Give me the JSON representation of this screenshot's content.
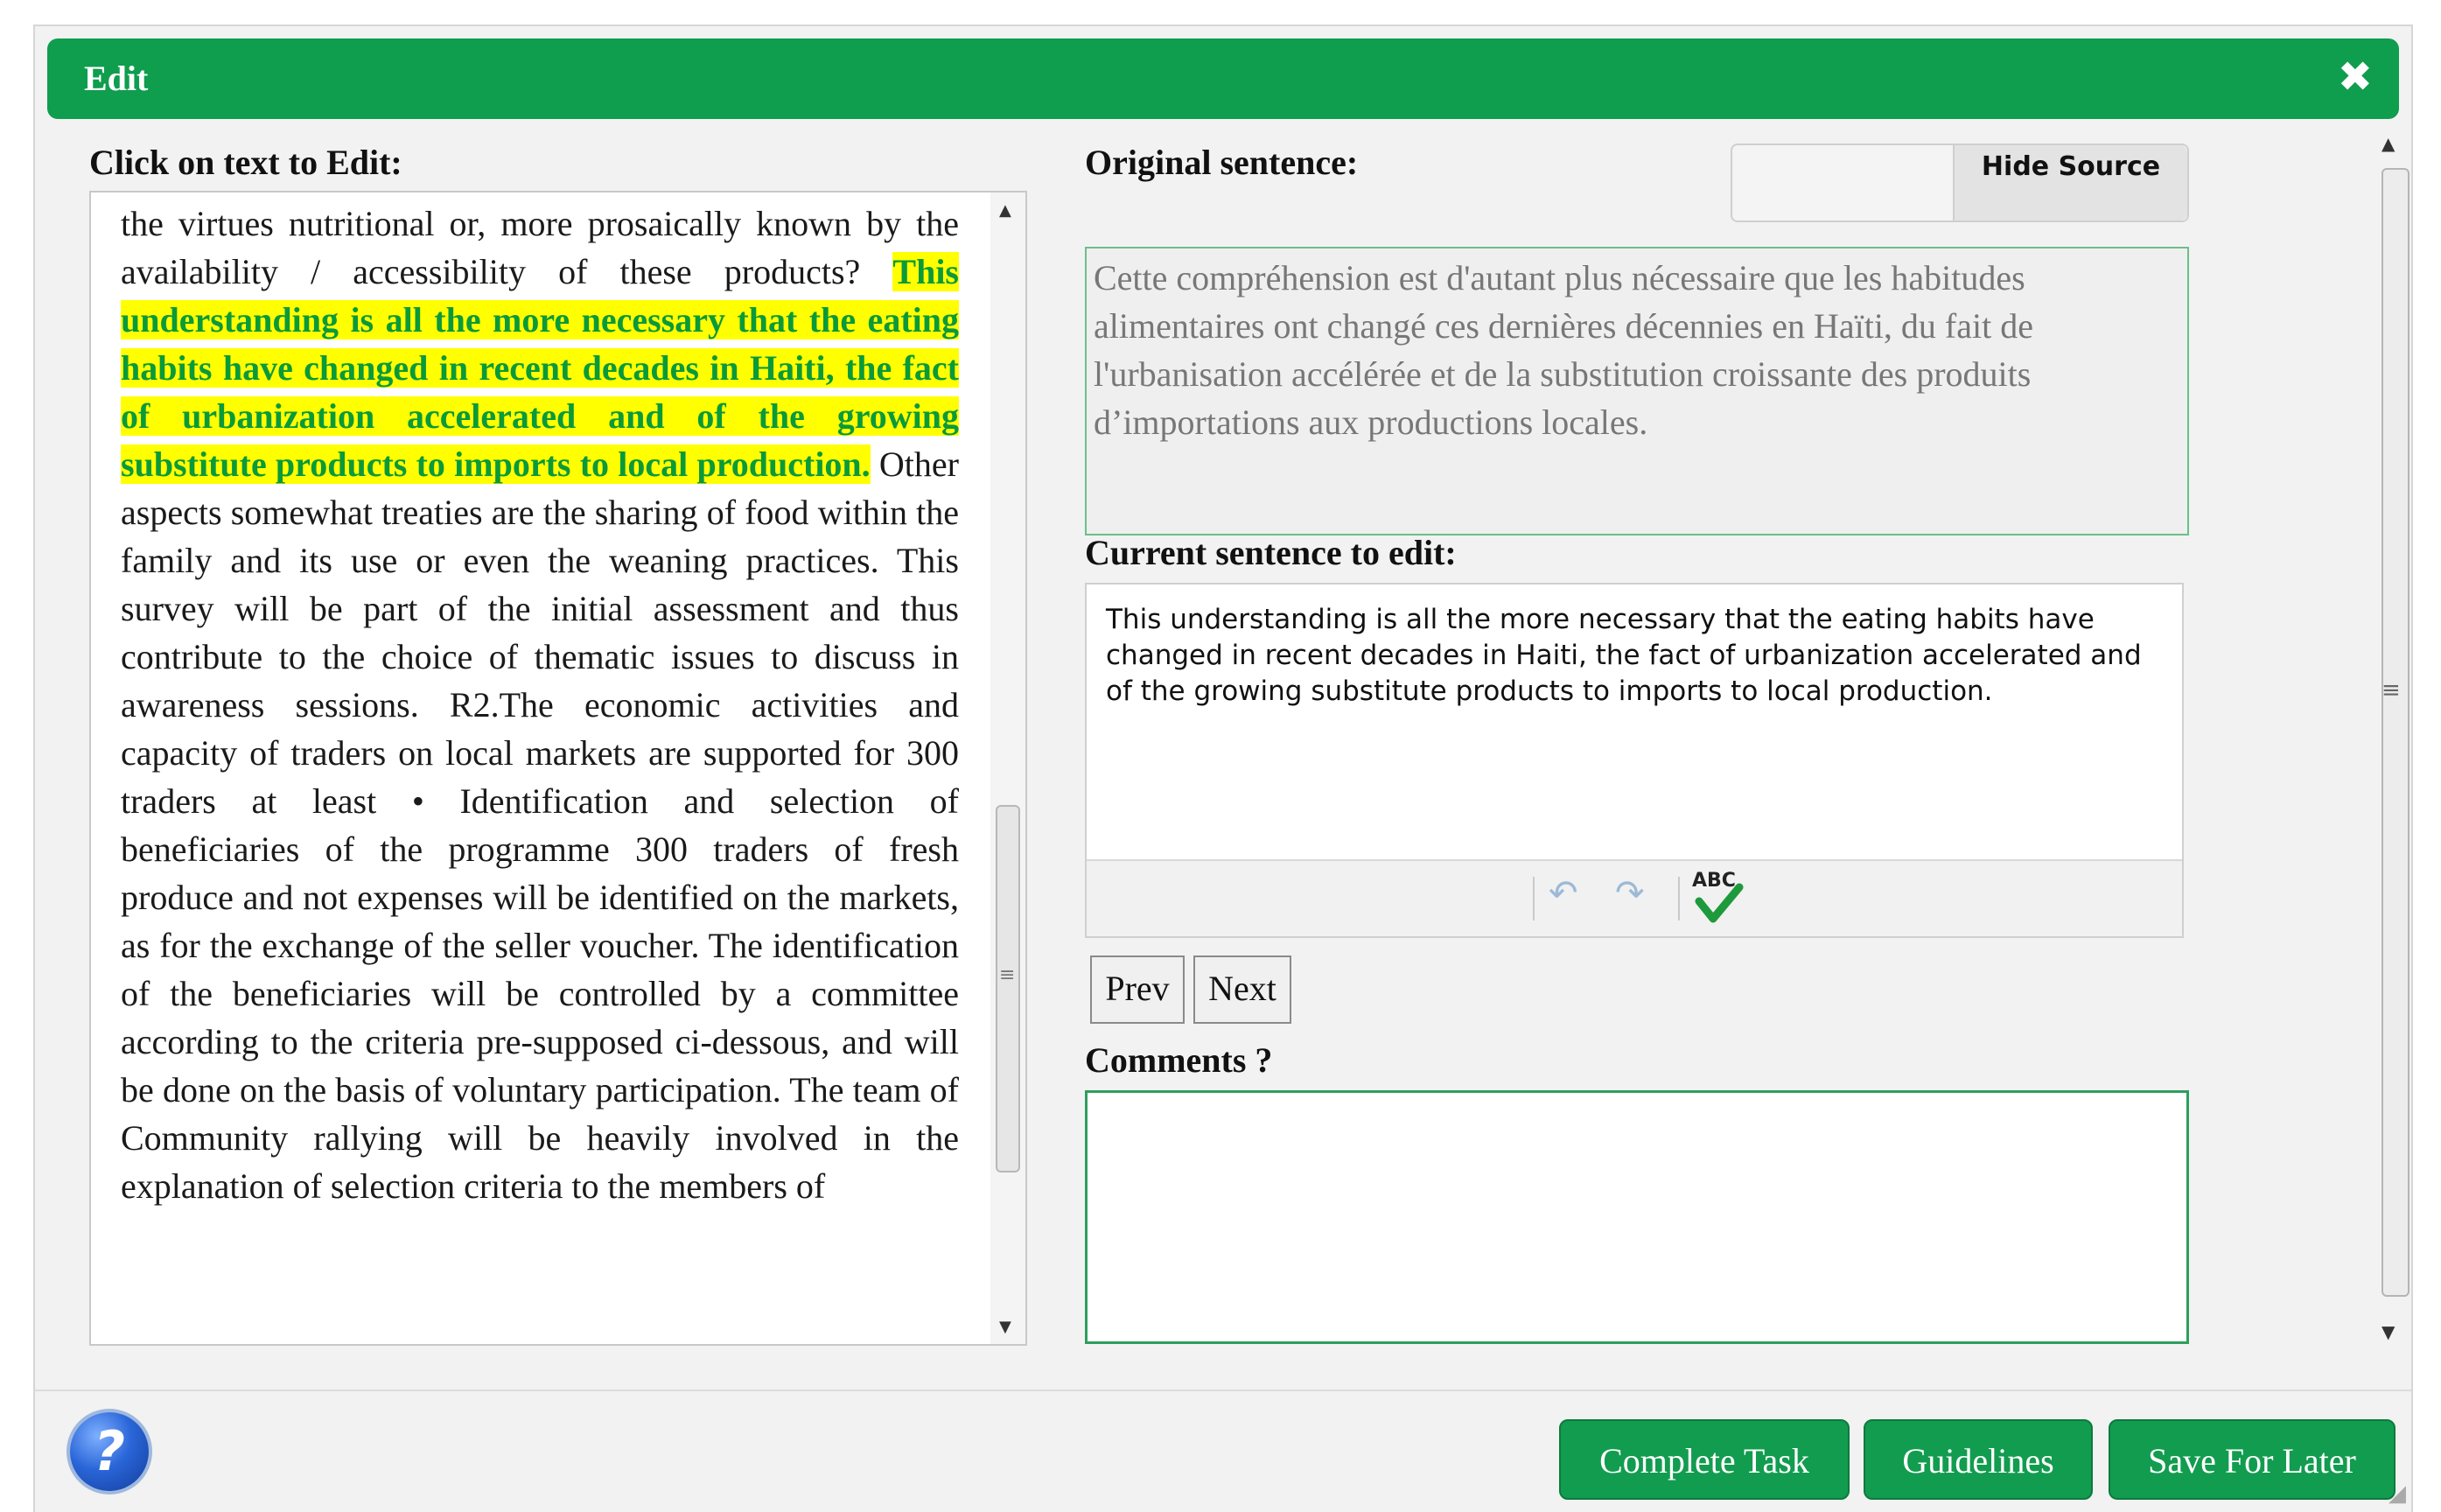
{
  "dialog": {
    "title": "Edit",
    "close_icon": "close-icon"
  },
  "left": {
    "label": "Click on text to Edit:",
    "text_before": "the virtues nutritional or, more prosaically known by the availability / accessibility of these products? ",
    "highlighted_text": "This understanding is all the more necessary that the eating habits have changed in recent decades in Haiti, the fact of urbanization accelerated and of the growing substitute products to imports to local production.",
    "text_after": " Other aspects somewhat treaties are the sharing of food within the family and its use or even the weaning practices. This survey will be part of the initial assessment and thus contribute to the choice of thematic issues to discuss in awareness sessions. R2.The economic activities and capacity of traders on local markets are supported for 300 traders at least • Identification and selection of beneficiaries of the programme 300 traders of fresh produce and not expenses will be identified on the markets, as for the exchange of the seller voucher. The identification of the beneficiaries will be controlled by a committee according to the criteria pre-supposed ci-dessous, and will be done on the basis of voluntary participation. The team of Community rallying will be heavily involved in the explanation of selection criteria to the members of"
  },
  "right": {
    "original_label": "Original sentence:",
    "hide_source_label": "Hide Source",
    "original_text": "Cette compréhension est d'autant plus nécessaire que les habitudes alimentaires ont changé ces dernières décennies en Haïti, du fait de l'urbanisation accélérée et de la substitution croissante des produits d’importations aux productions locales.",
    "current_label": "Current sentence to edit:",
    "current_text": "This understanding is all the more necessary that the eating habits have changed in recent decades in Haiti, the fact of urbanization accelerated and of the growing substitute products to imports to local production.",
    "spellcheck_text": "ABC",
    "prev_label": "Prev",
    "next_label": "Next",
    "comments_label": "Comments ?"
  },
  "footer": {
    "help_glyph": "?",
    "complete_label": "Complete Task",
    "guidelines_label": "Guidelines",
    "save_label": "Save For Later"
  },
  "colors": {
    "brand_green": "#0f9d4e",
    "highlight_bg": "#ffff00",
    "highlight_text": "#0a9a3a"
  }
}
